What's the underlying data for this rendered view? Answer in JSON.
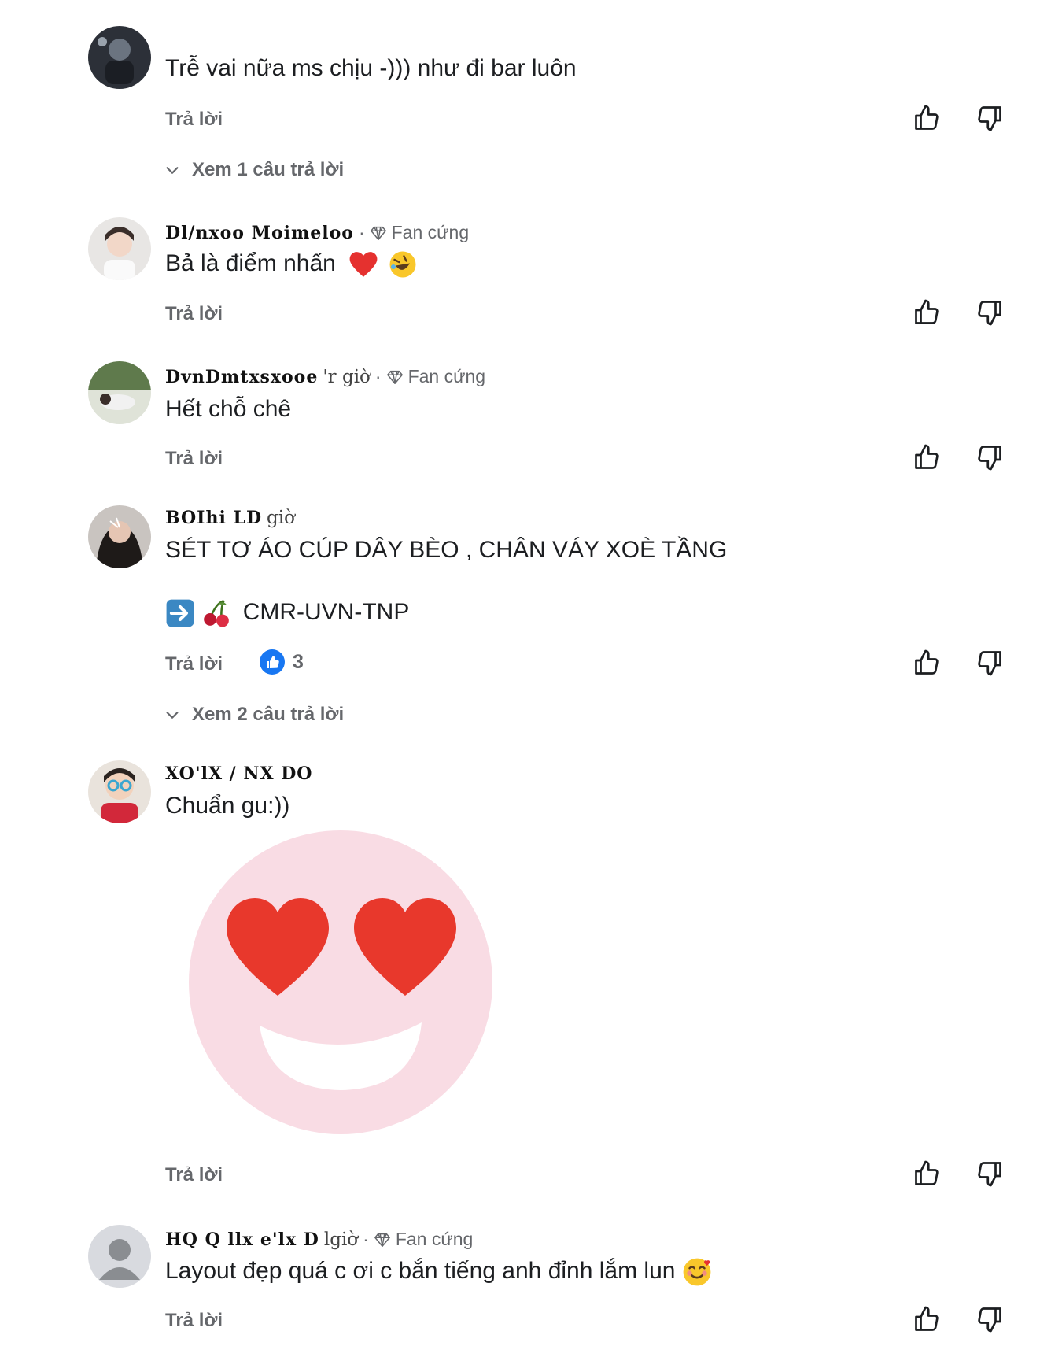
{
  "reply_label": "Trả lời",
  "comments": [
    {
      "text": "Trễ vai nữa ms chịu -))) như đi bar luôn",
      "view_replies": "Xem 1 câu trả lời"
    },
    {
      "author": "Dl/nxoo  Moimeloo",
      "time": "",
      "badge": "Fan cứng",
      "text": "Bả là điểm nhấn"
    },
    {
      "author": "DvnDmtxsxooe",
      "time": "'r giờ",
      "badge": "Fan cứng",
      "text": "Hết chỗ chê"
    },
    {
      "author": "BOIhi   LD",
      "time": "giờ",
      "text_line1": "SÉT TƠ ÁO CÚP DÂY BÈO , CHÂN VÁY XOÈ TẦNG",
      "text_line2": "CMR-UVN-TNP",
      "likes": "3",
      "view_replies": "Xem 2 câu trả lời"
    },
    {
      "author": "XO'lX  / NX DO",
      "text": "Chuẩn gu:))"
    },
    {
      "author": "HQ Q llx  e'lx  D",
      "time": "lgiờ",
      "badge": "Fan cứng",
      "text": "Layout đẹp quá c ơi c bắn tiếng anh đỉnh lắm lun"
    }
  ],
  "colors": {
    "secondary_text": "#65676b",
    "like_blue": "#1877f2",
    "sticker_face": "#f9dce4",
    "sticker_heart": "#e8382c"
  }
}
